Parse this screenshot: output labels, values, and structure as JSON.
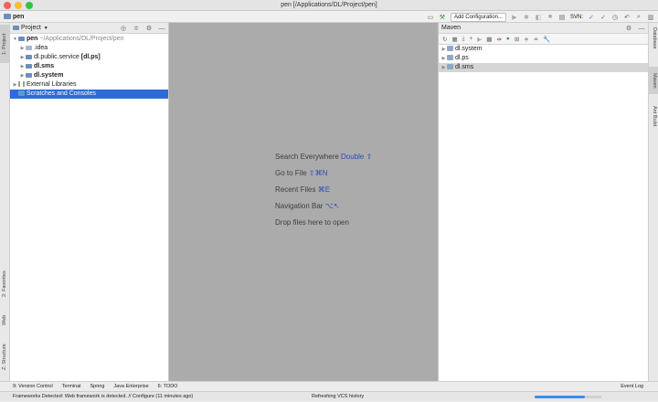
{
  "window": {
    "title": "pen [/Applications/DL/Project/pen]"
  },
  "navbar": {
    "project_name": "pen",
    "add_config_label": "Add Configuration...",
    "svn_label": "SVN:"
  },
  "left_tabs": [
    "1: Project",
    "2: Favorites",
    "Web",
    "Z: Structure"
  ],
  "right_tabs": [
    "Database",
    "Maven",
    "Ant Build"
  ],
  "project_panel": {
    "header": "Project",
    "tree": [
      {
        "label": "pen",
        "extra": " ~/Applications/DL/Project/pen",
        "level": 0,
        "expanded": true,
        "bold": true
      },
      {
        "label": ".idea",
        "level": 1,
        "expanded": false
      },
      {
        "label": "dl.public.service ",
        "extra": "[dl.ps]",
        "level": 1,
        "expanded": false
      },
      {
        "label": "dl.sms",
        "level": 1,
        "expanded": false,
        "bold": true
      },
      {
        "label": "dl.system",
        "level": 1,
        "expanded": false,
        "bold": true
      },
      {
        "label": "External Libraries",
        "level": 0,
        "expanded": false
      },
      {
        "label": "Scratches and Consoles",
        "level": 0,
        "selected": true
      }
    ]
  },
  "editor": {
    "hints": [
      {
        "text": "Search Everywhere ",
        "key": "Double ⇧"
      },
      {
        "text": "Go to File ",
        "key": "⇧⌘N"
      },
      {
        "text": "Recent Files ",
        "key": "⌘E"
      },
      {
        "text": "Navigation Bar ",
        "key": "⌥↖"
      },
      {
        "text": "Drop files here to open",
        "key": ""
      }
    ]
  },
  "maven": {
    "header": "Maven",
    "projects": [
      {
        "label": "dl.system"
      },
      {
        "label": "dl.ps"
      },
      {
        "label": "dl.sms",
        "selected": true
      }
    ]
  },
  "bottom_tools": [
    "9: Version Control",
    "Terminal",
    "Spring",
    "Java Enterprise",
    "6: TODO"
  ],
  "event_log": "Event Log",
  "status": {
    "message": "Frameworks Detected: Web framework is detected. // Configure (11 minutes ago)",
    "progress_text": "Refreshing VCS history",
    "progress": 0.75
  },
  "colors": {
    "selection": "#2e6bd9",
    "editor_bg": "#ababab",
    "key_text": "#2a4fb0"
  }
}
